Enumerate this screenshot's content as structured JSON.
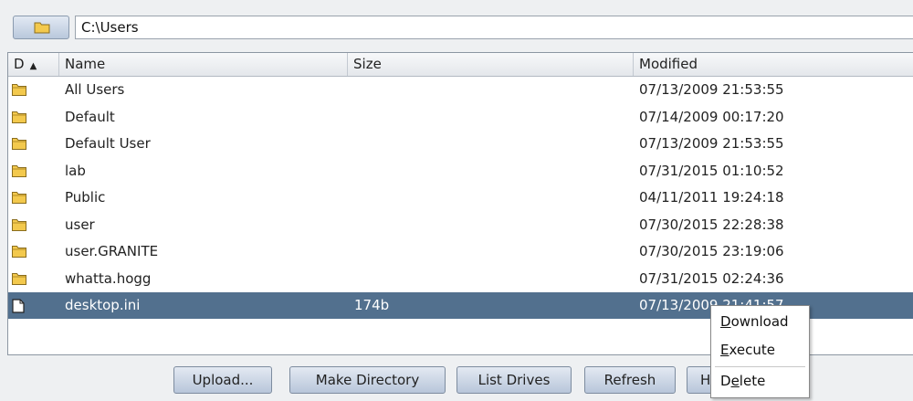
{
  "path": {
    "value": "C:\\Users"
  },
  "columns": {
    "d": "D",
    "sort_arrow": "▲",
    "name": "Name",
    "size": "Size",
    "modified": "Modified"
  },
  "rows": [
    {
      "type": "folder",
      "name": "All Users",
      "size": "",
      "modified": "07/13/2009 21:53:55"
    },
    {
      "type": "folder",
      "name": "Default",
      "size": "",
      "modified": "07/14/2009 00:17:20"
    },
    {
      "type": "folder",
      "name": "Default User",
      "size": "",
      "modified": "07/13/2009 21:53:55"
    },
    {
      "type": "folder",
      "name": "lab",
      "size": "",
      "modified": "07/31/2015 01:10:52"
    },
    {
      "type": "folder",
      "name": "Public",
      "size": "",
      "modified": "04/11/2011 19:24:18"
    },
    {
      "type": "folder",
      "name": "user",
      "size": "",
      "modified": "07/30/2015 22:28:38"
    },
    {
      "type": "folder",
      "name": "user.GRANITE",
      "size": "",
      "modified": "07/30/2015 23:19:06"
    },
    {
      "type": "folder",
      "name": "whatta.hogg",
      "size": "",
      "modified": "07/31/2015 02:24:36"
    },
    {
      "type": "file",
      "name": "desktop.ini",
      "size": "174b",
      "modified": "07/13/2009 21:41:57",
      "selected": true
    }
  ],
  "buttons": {
    "upload": "Upload...",
    "mkdir": "Make Directory",
    "drives": "List Drives",
    "refresh": "Refresh",
    "partial": "H"
  },
  "context_menu": {
    "download": {
      "key": "D",
      "rest": "ownload"
    },
    "execute": {
      "key": "E",
      "rest": "xecute"
    },
    "delete": {
      "pre": "D",
      "key": "e",
      "rest": "lete"
    }
  },
  "colors": {
    "selection": "#52708e",
    "folder": "#f3c94d",
    "button_top": "#e3e9f2",
    "button_bottom": "#b8c6da"
  },
  "icons": {
    "folder": "folder-icon",
    "file": "file-icon"
  }
}
